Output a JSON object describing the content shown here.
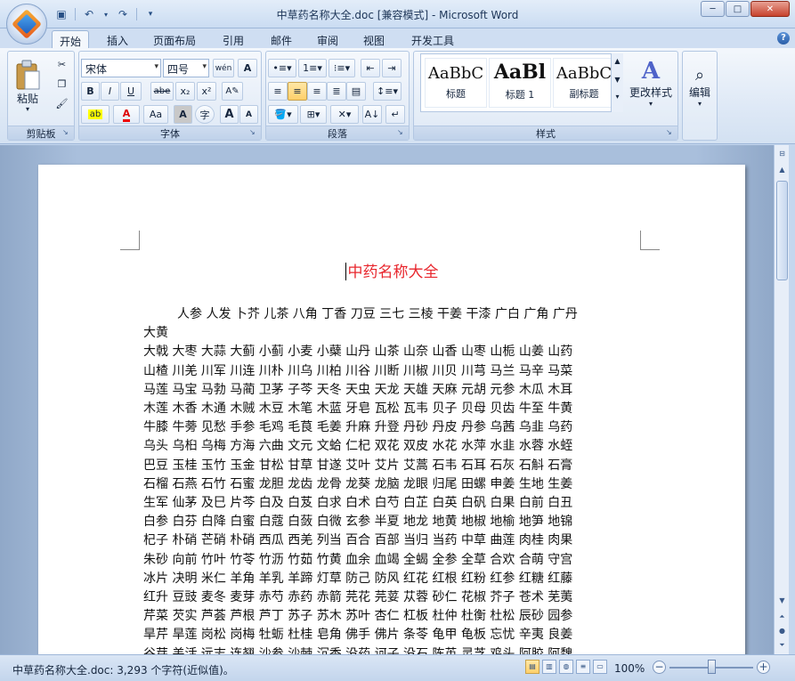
{
  "window": {
    "title": "中草药名称大全.doc [兼容模式] - Microsoft Word",
    "minimize": "─",
    "maximize": "□",
    "close": "✕"
  },
  "qat": {
    "save_icon": "save-icon",
    "undo_icon": "undo-icon",
    "redo_icon": "redo-icon"
  },
  "tabs": [
    "开始",
    "插入",
    "页面布局",
    "引用",
    "邮件",
    "审阅",
    "视图",
    "开发工具"
  ],
  "active_tab": "开始",
  "ribbon": {
    "clipboard": {
      "label": "剪贴板",
      "paste": "粘贴"
    },
    "font": {
      "label": "字体",
      "font_name": "宋体",
      "font_size": "四号",
      "bold": "B",
      "italic": "I",
      "underline": "U",
      "strike": "abe",
      "subscript": "x₂",
      "superscript": "x²",
      "grow": "A",
      "shrink": "A",
      "clear_format": "Aa",
      "wen": "wén",
      "char_border": "A",
      "char_shading": "A",
      "enclose": "字"
    },
    "paragraph": {
      "label": "段落"
    },
    "styles": {
      "label": "样式",
      "items": [
        {
          "sample": "AaBbC",
          "name": "标题"
        },
        {
          "sample": "AaBl",
          "name": "标题 1"
        },
        {
          "sample": "AaBbC",
          "name": "副标题"
        }
      ],
      "change_styles": "更改样式"
    },
    "editing": {
      "label": "编辑"
    }
  },
  "document": {
    "title": "中药名称大全",
    "lines": [
      "人参 人发 卜芥 儿茶 八角 丁香 刀豆 三七 三棱 干姜 干漆 广白 广角 广丹",
      "大黄",
      "大戟 大枣 大蒜 大蓟 小蓟 小麦 小蘗 山丹 山茶 山奈 山香 山枣 山栀 山姜 山药",
      "山楂 川羌 川军 川连 川朴 川乌 川柏 川谷 川断 川椒 川贝 川芎 马兰 马辛 马菜",
      "马莲 马宝 马勃 马蔺 卫茅 子芩 天冬 天虫 天龙 天雄 天麻 元胡 元参 木瓜 木耳",
      "木莲 木香 木通 木贼 木豆 木笔 木蓝 牙皂 瓦松 瓦韦 贝子 贝母 贝齿 牛至 牛黄",
      "牛膝 牛蒡 见愁 手参 毛鸡 毛茛 毛姜 升麻 升登 丹砂 丹皮 丹参 乌茜 乌韭 乌药",
      "乌头 乌桕 乌梅 方海 六曲 文元 文蛤 仁杞 双花 双皮 水花 水萍 水韭 水蓉 水蛭",
      "巴豆 玉桂 玉竹 玉金 甘松 甘草 甘遂 艾叶 艾片 艾蒿 石韦 石耳 石灰 石斛 石膏",
      "石榴 石燕 石竹 石蜜 龙胆 龙齿 龙骨 龙葵 龙脑 龙眼 归尾 田螺 申姜 生地 生姜",
      "生军 仙茅 及巳 片芩 白及 白芨 白求 白术 白芍 白芷 白英 白矾 白果 白前 白丑",
      "白参 白芬 白降 白蜜 白蔻 白蔹 白微 玄参 半夏 地龙 地黄 地椒 地榆 地笋 地锦",
      "杞子 朴硝 芒硝 朴硝 西瓜 西羌 列当 百合 百部 当归 当药 中草 曲莲 肉桂 肉果",
      "朱砂 向前 竹叶 竹苓 竹沥 竹茹 竹黄 血余 血竭 全蝎 全参 全草 合欢 合萌 守宫",
      "冰片 决明 米仁 羊角 羊乳 羊蹄 灯草 防己 防风 红花 红根 红粉 红参 红糖 红藤",
      "红升 豆豉 麦冬 麦芽 赤芍 赤药 赤箭 芫花 芫荽 苁蓉 砂仁 花椒 芥子 苍术 芜荑",
      "芹菜 芡实 芦荟 芦根 芦丁 苏子 苏木 苏叶 杏仁 杠板 杜仲 杜衡 杜松 辰砂 园参",
      "旱芹 旱莲 岗松 岗梅 牡蛎 杜桂 皂角 佛手 佛片 条苓 龟甲 龟板 忘忧 辛夷 良姜",
      "谷芽 羌活 远志 连翘 沙参 沙棘 沉香 没药 诃子 没石 陈英 灵芝 鸡头 阿胶 阿魏"
    ]
  },
  "status": {
    "text": "中草药名称大全.doc: 3,293 个字符(近似值)。",
    "zoom": "100%",
    "zoom_level": 1.0
  }
}
